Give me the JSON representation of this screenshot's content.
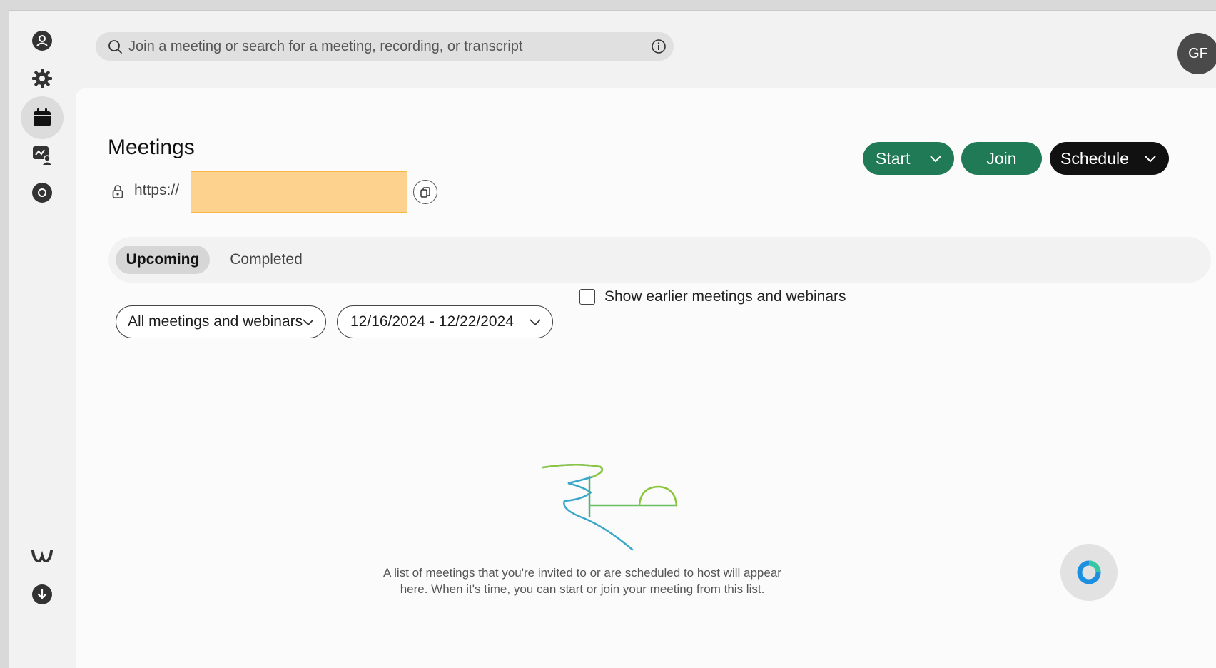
{
  "sidebar": {
    "items": [
      {
        "icon": "contacts-icon"
      },
      {
        "icon": "gear-icon"
      },
      {
        "icon": "calendar-icon",
        "active": true
      },
      {
        "icon": "whiteboard-icon"
      },
      {
        "icon": "record-icon"
      }
    ],
    "bottom": [
      {
        "icon": "webex-logo-icon"
      },
      {
        "icon": "download-icon"
      }
    ]
  },
  "search": {
    "placeholder": "Join a meeting or search for a meeting, recording, or transcript",
    "icon": "search-icon",
    "info_icon": "info-icon"
  },
  "user": {
    "initials": "GF"
  },
  "meetings": {
    "title": "Meetings",
    "url_prefix": "https://",
    "actions": {
      "start": "Start",
      "join": "Join",
      "schedule": "Schedule"
    }
  },
  "tabs": [
    {
      "label": "Upcoming",
      "active": true
    },
    {
      "label": "Completed",
      "active": false
    }
  ],
  "filters": {
    "type_selected": "All meetings and webinars",
    "date_range": "12/16/2024 - 12/22/2024",
    "show_earlier_label": "Show earlier meetings and webinars",
    "show_earlier_checked": false
  },
  "empty_state": {
    "line1": "A list of meetings that you're invited to or are scheduled to host will appear",
    "line2": "here. When it's time, you can start or join your meeting from this list."
  },
  "colors": {
    "accent_green": "#1f7a55",
    "schedule_dark": "#111111",
    "redaction": "#fdd28e",
    "annotation_arrow": "#f36b6b"
  }
}
